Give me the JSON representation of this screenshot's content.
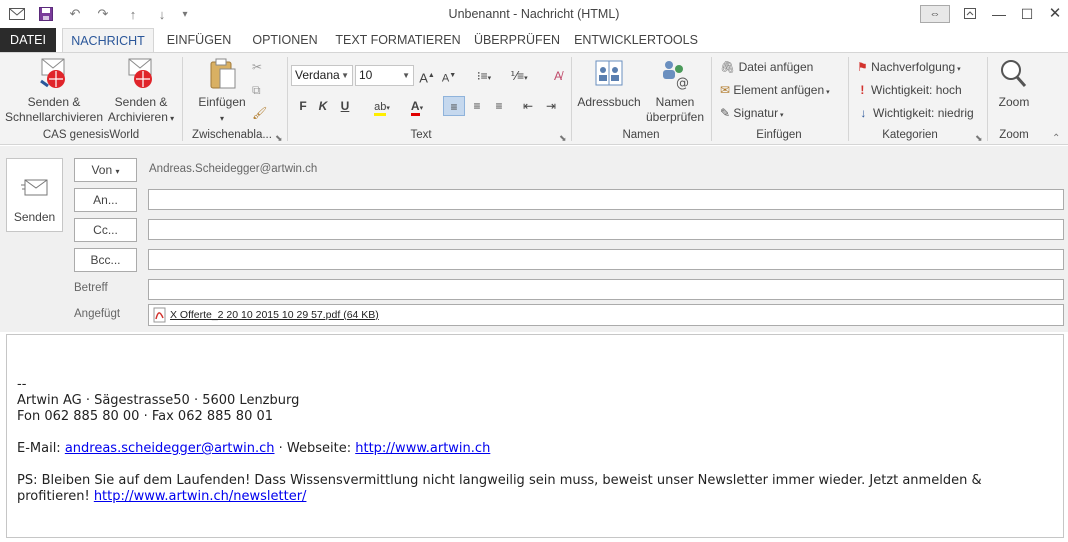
{
  "window": {
    "title": "Unbenannt - Nachricht (HTML)"
  },
  "tabs": [
    "DATEI",
    "NACHRICHT",
    "EINFÜGEN",
    "OPTIONEN",
    "TEXT FORMATIEREN",
    "ÜBERPRÜFEN",
    "ENTWICKLERTOOLS"
  ],
  "ribbon": {
    "cas": {
      "send_file_l1": "Senden &",
      "send_file_l2": "Schnellarchivieren",
      "send_arch_l1": "Senden &",
      "send_arch_l2": "Archivieren",
      "group": "CAS genesisWorld"
    },
    "clipboard": {
      "paste": "Einfügen",
      "group": "Zwischenabla..."
    },
    "text": {
      "font": "Verdana",
      "size": "10",
      "bold": "F",
      "italic": "K",
      "underline": "U",
      "group": "Text"
    },
    "names": {
      "addressbook": "Adressbuch",
      "check_l1": "Namen",
      "check_l2": "überprüfen",
      "group": "Namen"
    },
    "include": {
      "attach_file": "Datei anfügen",
      "attach_item": "Element anfügen",
      "signature": "Signatur",
      "group": "Einfügen"
    },
    "tags": {
      "followup": "Nachverfolgung",
      "high": "Wichtigkeit: hoch",
      "low": "Wichtigkeit: niedrig",
      "group": "Kategorien"
    },
    "zoom": {
      "zoom": "Zoom",
      "group": "Zoom"
    }
  },
  "compose": {
    "send": "Senden",
    "from_btn": "Von",
    "from_addr": "Andreas.Scheidegger@artwin.ch",
    "to_btn": "An...",
    "cc_btn": "Cc...",
    "bcc_btn": "Bcc...",
    "subject_label": "Betreff",
    "subject_value": "",
    "attached_label": "Angefügt",
    "attachment": "X Offerte_2 20 10 2015 10 29 57.pdf (64 KB)"
  },
  "body": {
    "sig_dash": "--",
    "company": "Artwin AG · Sägestrasse50 · 5600 Lenzburg",
    "phone": "Fon 062 885 80 00 · Fax 062 885 80 01",
    "email_prefix": "E-Mail: ",
    "email": "andreas.scheidegger@artwin.ch",
    "web_prefix": " · Webseite: ",
    "web": "http://www.artwin.ch",
    "ps": "PS: Bleiben Sie auf dem Laufenden! Dass Wissensvermittlung nicht langweilig sein muss, beweist unser Newsletter immer wieder. Jetzt anmelden & profitieren! ",
    "newsletter": "http://www.artwin.ch/newsletter/"
  },
  "colors": {
    "accent": "#2b579a",
    "file_tab": "#2b2b2b",
    "link": "#0000ee"
  }
}
